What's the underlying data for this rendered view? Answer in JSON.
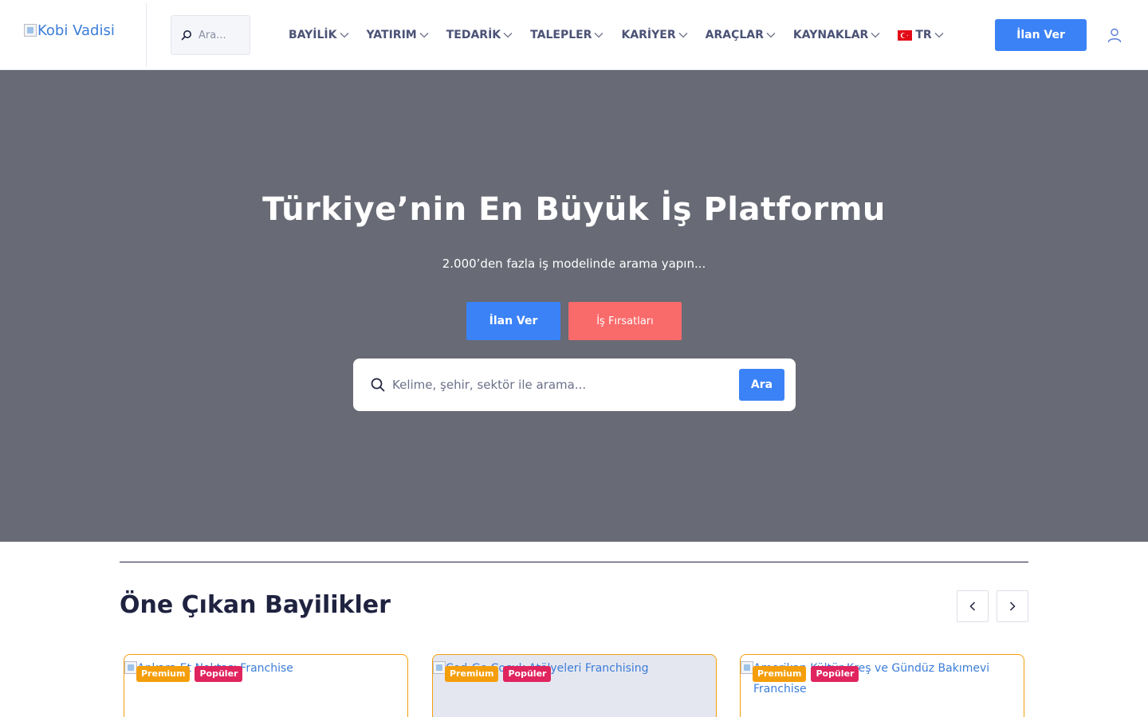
{
  "header": {
    "logo_alt": "Kobi Vadisi",
    "search_placeholder": "Ara...",
    "nav": [
      {
        "label": "BAYİLİK"
      },
      {
        "label": "YATIRIM"
      },
      {
        "label": "TEDARİK"
      },
      {
        "label": "TALEPLER"
      },
      {
        "label": "KARİYER"
      },
      {
        "label": "ARAÇLAR"
      },
      {
        "label": "KAYNAKLAR"
      }
    ],
    "language": "TR",
    "cta_label": "İlan Ver"
  },
  "hero": {
    "title": "Türkiye’nin En Büyük İş Platformu",
    "subtitle": "2.000’den fazla iş modelinde arama yapın...",
    "primary_button": "İlan Ver",
    "secondary_button": "İş Fırsatları",
    "search_placeholder": "Kelime, şehir, sektör ile arama...",
    "search_button": "Ara"
  },
  "featured": {
    "title": "Öne Çıkan Bayilikler",
    "cards": [
      {
        "alt": "Ankara Et Noktası Franchise",
        "badges": [
          "Premium",
          "Popüler"
        ]
      },
      {
        "alt": "Cod-Go Çocuk Atölyeleri Franchising",
        "badges": [
          "Premium",
          "Popüler"
        ]
      },
      {
        "alt": "Amerikan Kültür Kreş ve Gündüz Bakımevi Franchise",
        "badges": [
          "Premium",
          "Popüler"
        ]
      }
    ]
  },
  "colors": {
    "primary": "#3b82f6",
    "secondary": "#f96a6a",
    "hero_bg": "#686a75",
    "premium": "#f59e0b",
    "popular": "#e0245e"
  }
}
